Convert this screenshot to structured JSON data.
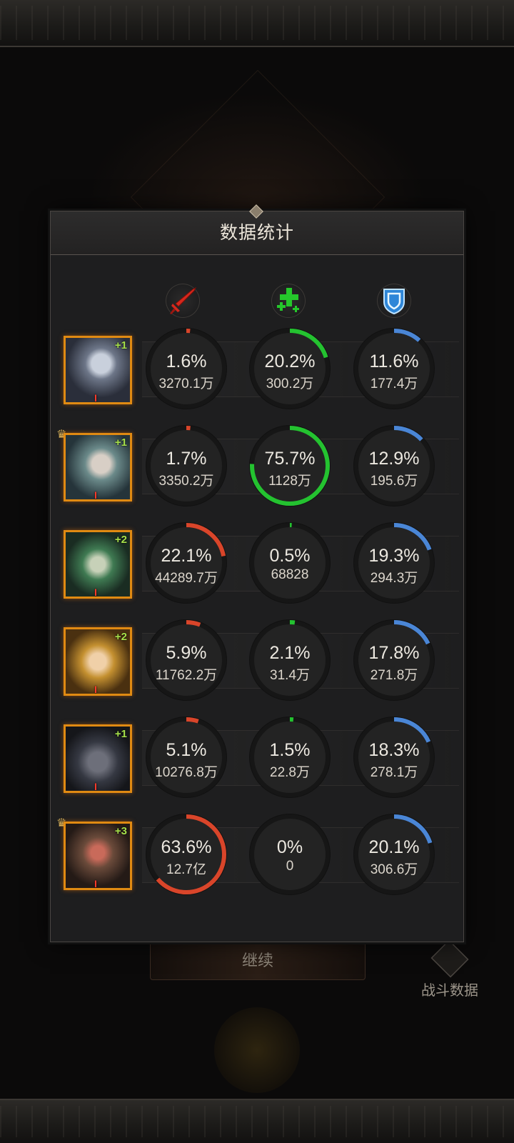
{
  "dialog": {
    "title": "数据统计"
  },
  "columns": [
    {
      "icon": "sword-icon",
      "color": "#d5281d"
    },
    {
      "icon": "heal-plus-icon",
      "color": "#25c72b"
    },
    {
      "icon": "shield-icon",
      "color": "#4b8fe0"
    }
  ],
  "colors": {
    "damage": "#d9452a",
    "heal": "#24c230",
    "shield": "#4a86d6",
    "frame": "#e08a12"
  },
  "heroes": [
    {
      "plus": "+1",
      "rank": "I",
      "crown": false,
      "stats": [
        {
          "pct": "1.6%",
          "val": "3270.1万",
          "frac": 0.016
        },
        {
          "pct": "20.2%",
          "val": "300.2万",
          "frac": 0.202
        },
        {
          "pct": "11.6%",
          "val": "177.4万",
          "frac": 0.116
        }
      ]
    },
    {
      "plus": "+1",
      "rank": "I",
      "crown": true,
      "stats": [
        {
          "pct": "1.7%",
          "val": "3350.2万",
          "frac": 0.017
        },
        {
          "pct": "75.7%",
          "val": "1128万",
          "frac": 0.757
        },
        {
          "pct": "12.9%",
          "val": "195.6万",
          "frac": 0.129
        }
      ]
    },
    {
      "plus": "+2",
      "rank": "I",
      "crown": false,
      "stats": [
        {
          "pct": "22.1%",
          "val": "44289.7万",
          "frac": 0.221
        },
        {
          "pct": "0.5%",
          "val": "68828",
          "frac": 0.005
        },
        {
          "pct": "19.3%",
          "val": "294.3万",
          "frac": 0.193
        }
      ]
    },
    {
      "plus": "+2",
      "rank": "I",
      "crown": false,
      "stats": [
        {
          "pct": "5.9%",
          "val": "11762.2万",
          "frac": 0.059
        },
        {
          "pct": "2.1%",
          "val": "31.4万",
          "frac": 0.021
        },
        {
          "pct": "17.8%",
          "val": "271.8万",
          "frac": 0.178
        }
      ]
    },
    {
      "plus": "+1",
      "rank": "I",
      "crown": false,
      "stats": [
        {
          "pct": "5.1%",
          "val": "10276.8万",
          "frac": 0.051
        },
        {
          "pct": "1.5%",
          "val": "22.8万",
          "frac": 0.015
        },
        {
          "pct": "18.3%",
          "val": "278.1万",
          "frac": 0.183
        }
      ]
    },
    {
      "plus": "+3",
      "rank": "I",
      "crown": true,
      "stats": [
        {
          "pct": "63.6%",
          "val": "12.7亿",
          "frac": 0.636
        },
        {
          "pct": "0%",
          "val": "0",
          "frac": 0
        },
        {
          "pct": "20.1%",
          "val": "306.6万",
          "frac": 0.201
        }
      ]
    }
  ],
  "background": {
    "continue_label": "继续",
    "battle_data_label": "战斗数据"
  }
}
